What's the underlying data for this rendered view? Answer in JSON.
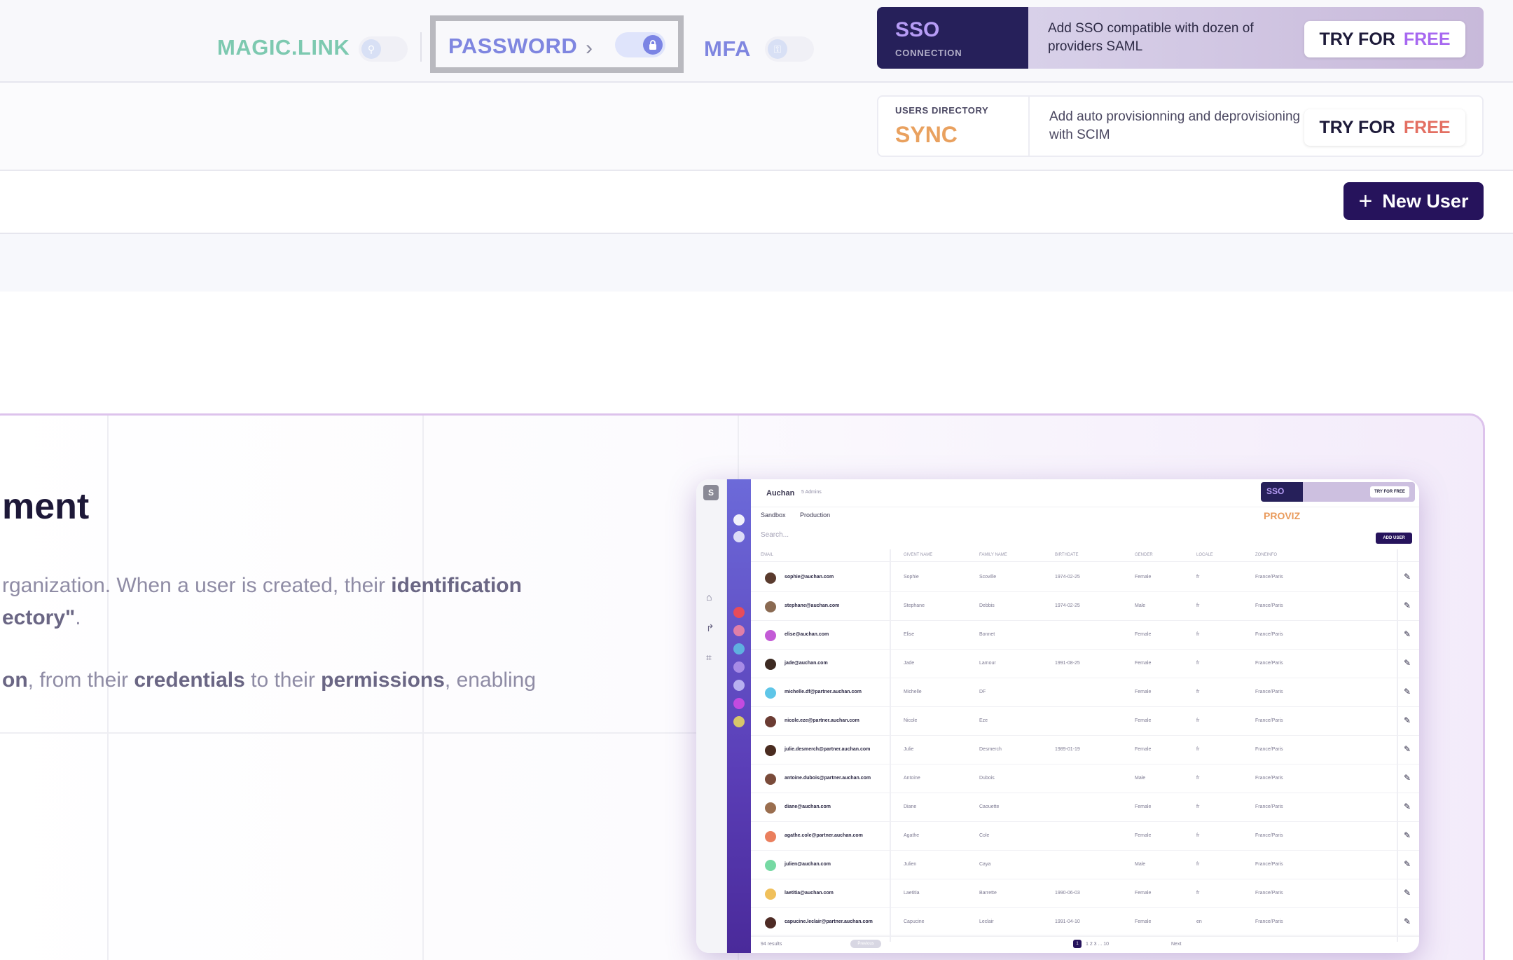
{
  "connections": {
    "magic_link": {
      "label": "MAGIC.LINK",
      "enabled": false,
      "icon": "link-icon"
    },
    "password": {
      "label": "PASSWORD",
      "enabled": true,
      "icon": "lock-icon"
    },
    "mfa": {
      "label": "MFA",
      "enabled": false,
      "icon": "key-icon"
    }
  },
  "sso_banner": {
    "tag_big": "SSO",
    "tag_small": "CONNECTION",
    "text": "Add SSO compatible with dozen of providers SAML",
    "cta_try": "TRY FOR",
    "cta_free": "FREE"
  },
  "sync_banner": {
    "tag_small": "USERS DIRECTORY",
    "tag_big": "SYNC",
    "text": "Add auto provisionning and deprovisioning with SCIM",
    "cta_try": "TRY FOR",
    "cta_free": "FREE"
  },
  "toolbar": {
    "new_user_label": "New User",
    "plus": "+"
  },
  "feature": {
    "heading": "ment",
    "p1_a": "rganization. When a user is created, their ",
    "p1_b": "identification",
    "p2_a": "ectory\"",
    "p2_b": ".",
    "p3_a": "on",
    "p3_b": ", from their ",
    "p3_c": "credentials",
    "p3_d": " to their ",
    "p3_e": "permissions",
    "p3_f": ", enabling"
  },
  "preview": {
    "rail_letter": "S",
    "org": "Auchan",
    "admins": "5 Admins",
    "tab_sandbox": "Sandbox",
    "tab_production": "Production",
    "search_placeholder": "Search...",
    "add_user": "ADD USER",
    "sso": "SSO",
    "try_free": "TRY FOR FREE",
    "proviz": "PROVIZ",
    "columns": [
      "EMAIL",
      "GIVENT NAME",
      "FAMILY NAME",
      "BIRTHDATE",
      "GENDER",
      "LOCALE",
      "ZONEINFO"
    ],
    "rows": [
      {
        "email": "sophie@auchan.com",
        "given": "Sophie",
        "family": "Scoville",
        "birth": "1974-02-25",
        "gender": "Female",
        "locale": "fr",
        "zone": "France/Paris",
        "avatar": "#5a3b2e"
      },
      {
        "email": "stephane@auchan.com",
        "given": "Stephane",
        "family": "Debbis",
        "birth": "1974-02-25",
        "gender": "Male",
        "locale": "fr",
        "zone": "France/Paris",
        "avatar": "#8a6a52"
      },
      {
        "email": "elise@auchan.com",
        "given": "Elise",
        "family": "Bonnet",
        "birth": "",
        "gender": "Female",
        "locale": "fr",
        "zone": "France/Paris",
        "avatar": "#c35bd6"
      },
      {
        "email": "jade@auchan.com",
        "given": "Jade",
        "family": "Lamour",
        "birth": "1991-08-25",
        "gender": "Female",
        "locale": "fr",
        "zone": "France/Paris",
        "avatar": "#3d2a22"
      },
      {
        "email": "michelle.df@partner.auchan.com",
        "given": "Michelle",
        "family": "DF",
        "birth": "",
        "gender": "Female",
        "locale": "fr",
        "zone": "France/Paris",
        "avatar": "#5fc6e8"
      },
      {
        "email": "nicole.eze@partner.auchan.com",
        "given": "Nicole",
        "family": "Eze",
        "birth": "",
        "gender": "Female",
        "locale": "fr",
        "zone": "France/Paris",
        "avatar": "#6b3c33"
      },
      {
        "email": "julie.desmerch@partner.auchan.com",
        "given": "Julie",
        "family": "Desmerch",
        "birth": "1989-01-19",
        "gender": "Female",
        "locale": "fr",
        "zone": "France/Paris",
        "avatar": "#4a2c20"
      },
      {
        "email": "antoine.dubois@partner.auchan.com",
        "given": "Antoine",
        "family": "Dubois",
        "birth": "",
        "gender": "Male",
        "locale": "fr",
        "zone": "France/Paris",
        "avatar": "#7a4b3a"
      },
      {
        "email": "diane@auchan.com",
        "given": "Diane",
        "family": "Caouette",
        "birth": "",
        "gender": "Female",
        "locale": "fr",
        "zone": "France/Paris",
        "avatar": "#9a6e4f"
      },
      {
        "email": "agathe.cole@partner.auchan.com",
        "given": "Agathe",
        "family": "Cole",
        "birth": "",
        "gender": "Female",
        "locale": "fr",
        "zone": "France/Paris",
        "avatar": "#ea7f5e"
      },
      {
        "email": "julien@auchan.com",
        "given": "Julien",
        "family": "Caya",
        "birth": "",
        "gender": "Male",
        "locale": "fr",
        "zone": "France/Paris",
        "avatar": "#76d9a3"
      },
      {
        "email": "laetitia@auchan.com",
        "given": "Laetitia",
        "family": "Barrette",
        "birth": "1990-06-03",
        "gender": "Female",
        "locale": "fr",
        "zone": "France/Paris",
        "avatar": "#f0c05b"
      },
      {
        "email": "capucine.leclair@partner.auchan.com",
        "given": "Capucine",
        "family": "Leclair",
        "birth": "1991-04-10",
        "gender": "Female",
        "locale": "en",
        "zone": "France/Paris",
        "avatar": "#4e2b25"
      }
    ],
    "results": "94 results",
    "previous": "Previous",
    "pages": "1  2  3  ...  10",
    "next": "Next"
  },
  "colors": {
    "brand_dark": "#26135c",
    "magic_link": "#7dc9b0",
    "password": "#7f86e0",
    "sso_accent": "#b69cf5",
    "sync_accent": "#e9a15f",
    "free_purple": "#a768f0",
    "free_red": "#e36f62"
  }
}
